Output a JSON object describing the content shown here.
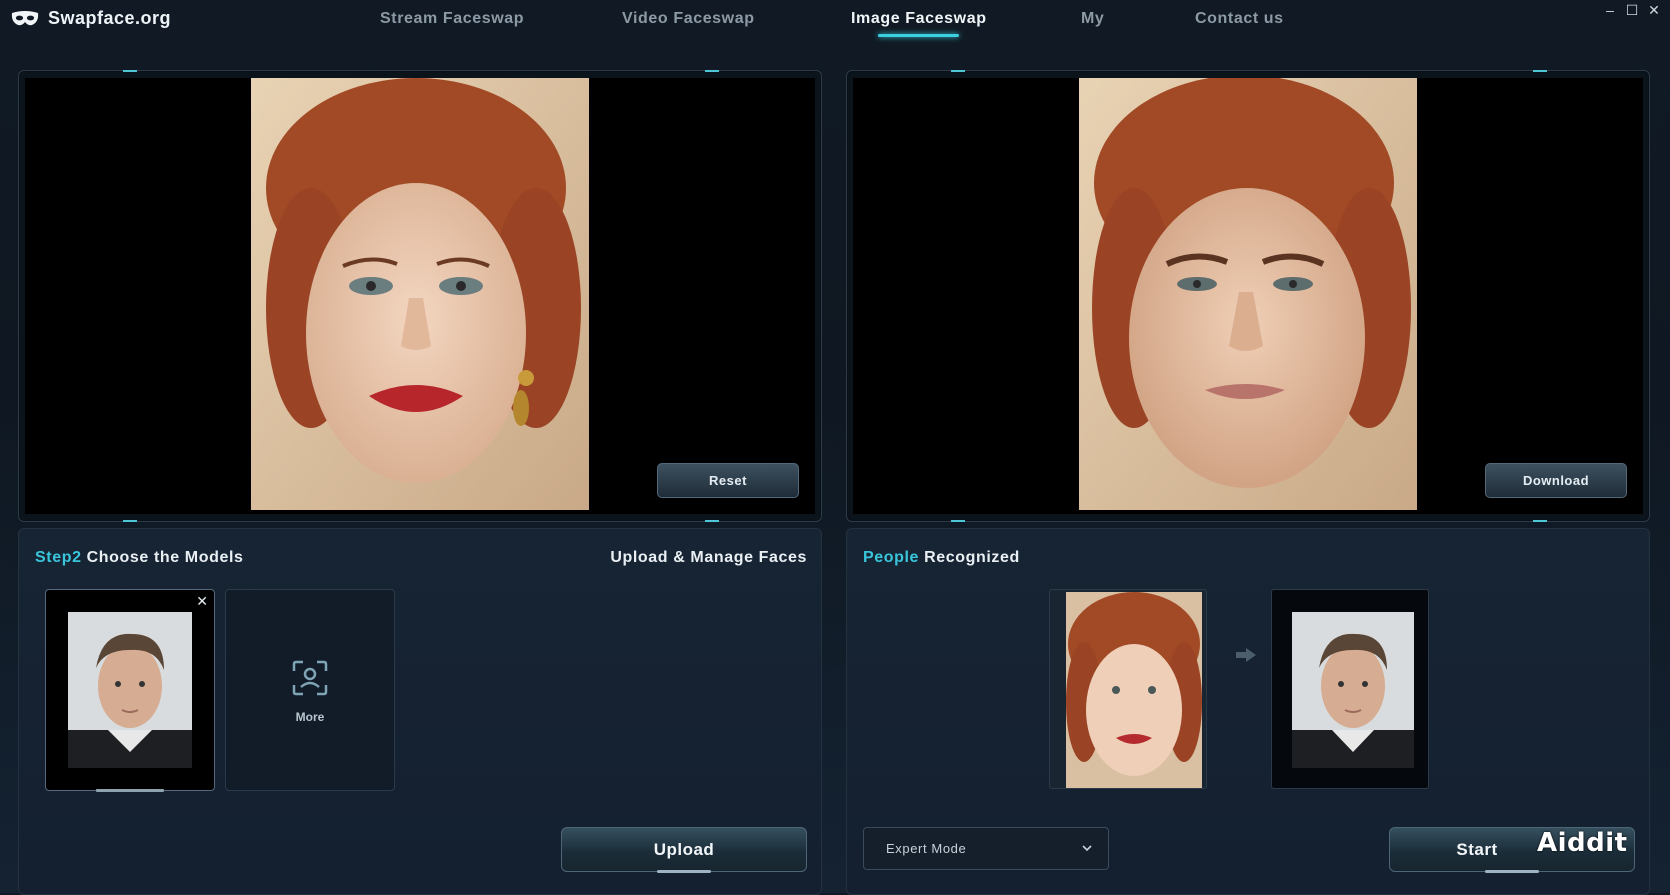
{
  "app": {
    "title": "Swapface.org",
    "accent_color": "#39c6dc"
  },
  "nav": {
    "items": [
      {
        "label": "Stream Faceswap",
        "active": false
      },
      {
        "label": "Video Faceswap",
        "active": false
      },
      {
        "label": "Image Faceswap",
        "active": true
      },
      {
        "label": "My",
        "active": false
      },
      {
        "label": "Contact us",
        "active": false
      }
    ]
  },
  "window_controls": {
    "minimize": "–",
    "maximize": "☐",
    "close": "✕"
  },
  "source_panel": {
    "image": "source-portrait-red-curly-hair-woman",
    "reset_label": "Reset"
  },
  "result_panel": {
    "image": "result-portrait-swapped-face",
    "download_label": "Download"
  },
  "models": {
    "step_label": "Step2",
    "title_rest": "Choose the Models",
    "manage_label": "Upload & Manage Faces",
    "cards": [
      {
        "type": "face",
        "image": "male-headshot",
        "selected": true,
        "close_icon": "✕"
      },
      {
        "type": "more",
        "icon": "face-scan-icon",
        "label": "More"
      }
    ],
    "upload_label": "Upload"
  },
  "recognized": {
    "title_accent": "People",
    "title_rest": "Recognized",
    "source_face": "source-face-thumbnail",
    "target_face": "target-face-thumbnail",
    "arrow_icon": "arrow-right-icon"
  },
  "controls": {
    "mode_value": "Expert Mode",
    "start_label": "Start"
  },
  "watermark": {
    "text": "Aiddit"
  }
}
